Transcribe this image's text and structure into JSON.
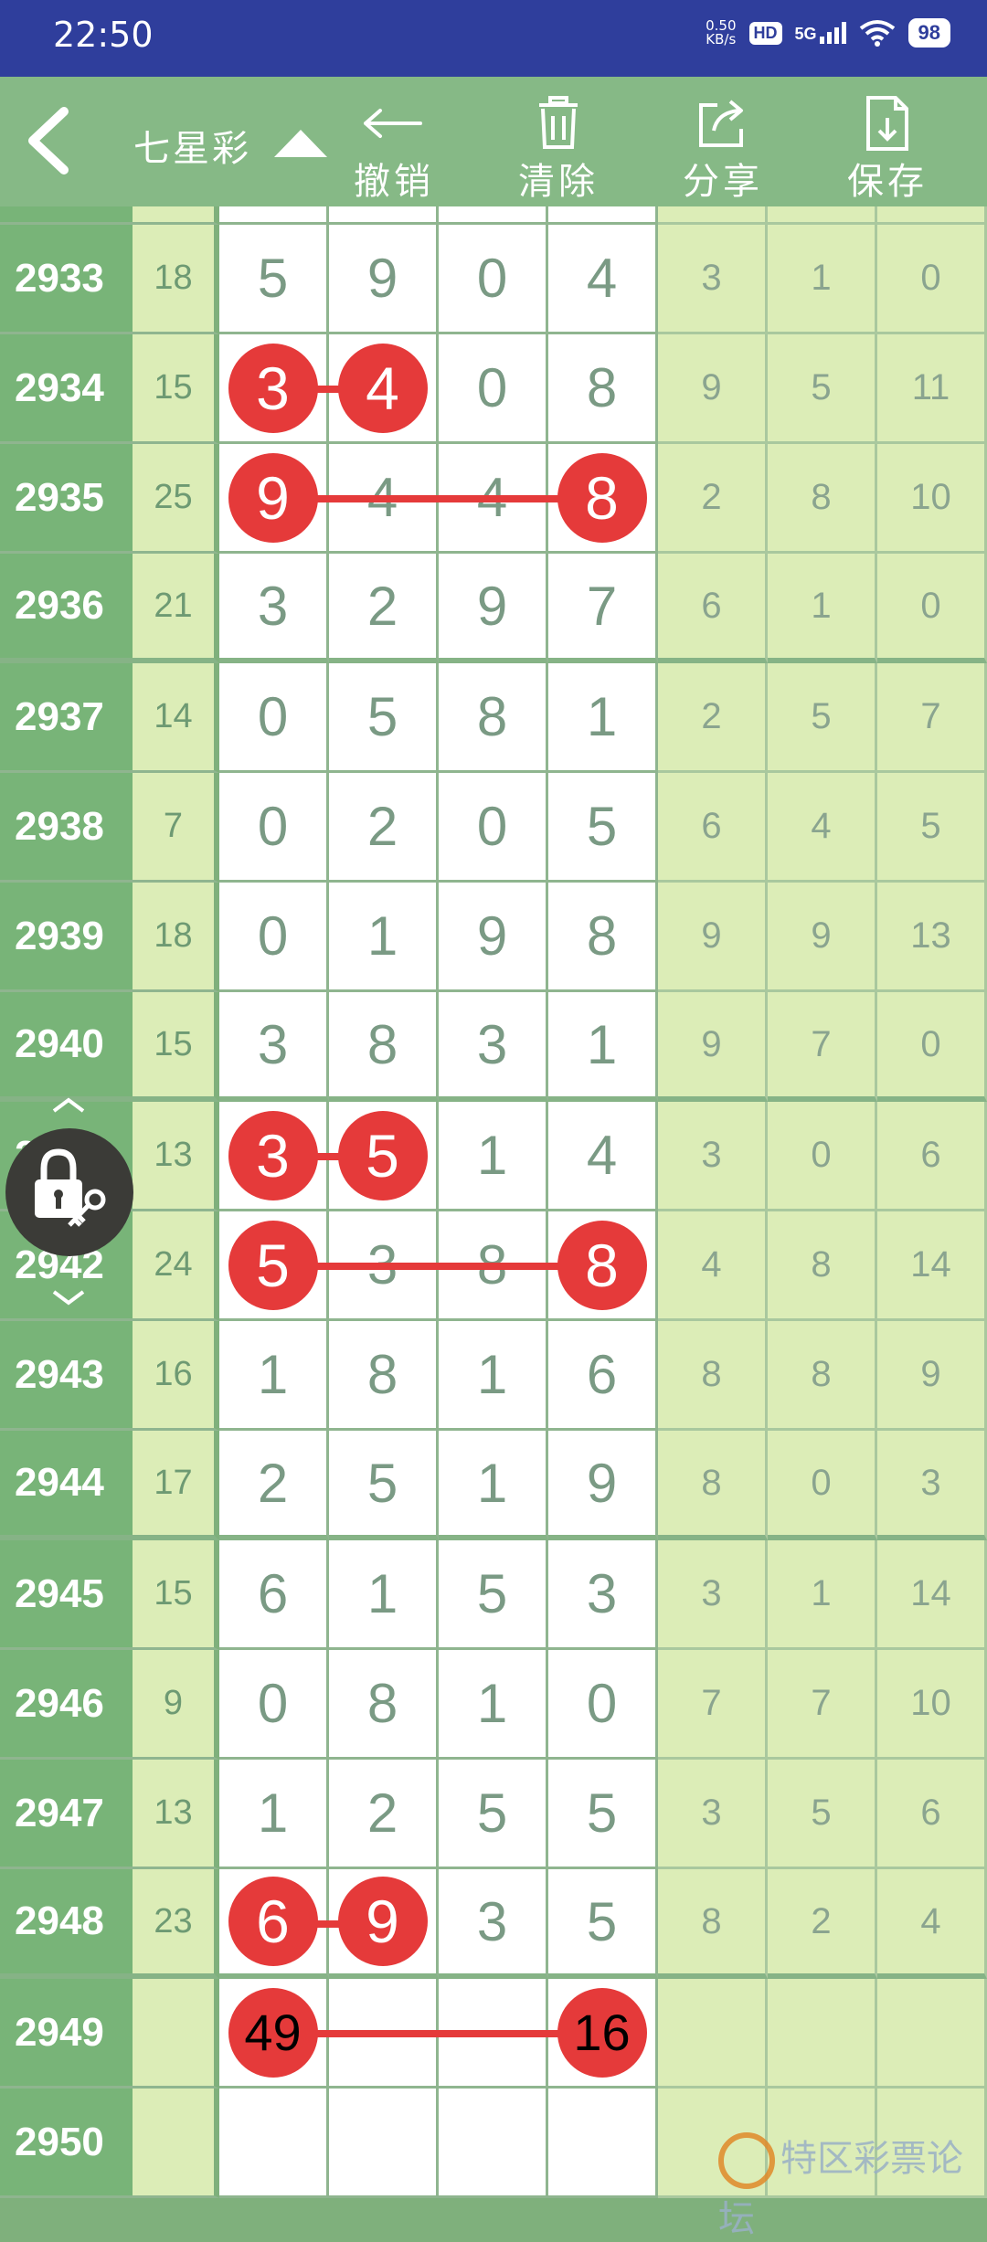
{
  "status": {
    "time": "22:50",
    "net_speed_value": "0.50",
    "net_speed_unit": "KB/s",
    "hd": "HD",
    "network": "5G",
    "battery": "98"
  },
  "toolbar": {
    "title": "七星彩",
    "undo_label": "撤销",
    "clear_label": "清除",
    "share_label": "分享",
    "save_label": "保存"
  },
  "rows": [
    {
      "period": "2933",
      "sum": "18",
      "digits": [
        "5",
        "9",
        "0",
        "4"
      ],
      "stats": [
        "3",
        "1",
        "0"
      ]
    },
    {
      "period": "2934",
      "sum": "15",
      "digits": [
        "3",
        "4",
        "0",
        "8"
      ],
      "stats": [
        "9",
        "5",
        "11"
      ],
      "balls": [
        0,
        1
      ]
    },
    {
      "period": "2935",
      "sum": "25",
      "digits": [
        "9",
        "4",
        "4",
        "8"
      ],
      "stats": [
        "2",
        "8",
        "10"
      ],
      "balls": [
        0,
        3
      ]
    },
    {
      "period": "2936",
      "sum": "21",
      "digits": [
        "3",
        "2",
        "9",
        "7"
      ],
      "stats": [
        "6",
        "1",
        "0"
      ]
    },
    {
      "period": "2937",
      "sum": "14",
      "digits": [
        "0",
        "5",
        "8",
        "1"
      ],
      "stats": [
        "2",
        "5",
        "7"
      ]
    },
    {
      "period": "2938",
      "sum": "7",
      "digits": [
        "0",
        "2",
        "0",
        "5"
      ],
      "stats": [
        "6",
        "4",
        "5"
      ]
    },
    {
      "period": "2939",
      "sum": "18",
      "digits": [
        "0",
        "1",
        "9",
        "8"
      ],
      "stats": [
        "9",
        "9",
        "13"
      ]
    },
    {
      "period": "2940",
      "sum": "15",
      "digits": [
        "3",
        "8",
        "3",
        "1"
      ],
      "stats": [
        "9",
        "7",
        "0"
      ]
    },
    {
      "period": "2941",
      "sum": "13",
      "digits": [
        "3",
        "5",
        "1",
        "4"
      ],
      "stats": [
        "3",
        "0",
        "6"
      ],
      "balls": [
        0,
        1
      ]
    },
    {
      "period": "2942",
      "sum": "24",
      "digits": [
        "5",
        "3",
        "8",
        "8"
      ],
      "stats": [
        "4",
        "8",
        "14"
      ],
      "balls": [
        0,
        3
      ]
    },
    {
      "period": "2943",
      "sum": "16",
      "digits": [
        "1",
        "8",
        "1",
        "6"
      ],
      "stats": [
        "8",
        "8",
        "9"
      ]
    },
    {
      "period": "2944",
      "sum": "17",
      "digits": [
        "2",
        "5",
        "1",
        "9"
      ],
      "stats": [
        "8",
        "0",
        "3"
      ]
    },
    {
      "period": "2945",
      "sum": "15",
      "digits": [
        "6",
        "1",
        "5",
        "3"
      ],
      "stats": [
        "3",
        "1",
        "14"
      ]
    },
    {
      "period": "2946",
      "sum": "9",
      "digits": [
        "0",
        "8",
        "1",
        "0"
      ],
      "stats": [
        "7",
        "7",
        "10"
      ]
    },
    {
      "period": "2947",
      "sum": "13",
      "digits": [
        "1",
        "2",
        "5",
        "5"
      ],
      "stats": [
        "3",
        "5",
        "6"
      ]
    },
    {
      "period": "2948",
      "sum": "23",
      "digits": [
        "6",
        "9",
        "3",
        "5"
      ],
      "stats": [
        "8",
        "2",
        "4"
      ],
      "balls": [
        0,
        1
      ]
    },
    {
      "period": "2949",
      "sum": "",
      "digits": [
        "49",
        "",
        "",
        "16"
      ],
      "stats": [
        "",
        "",
        ""
      ],
      "balls": [
        0,
        3
      ],
      "dark": true
    },
    {
      "period": "2950",
      "sum": "",
      "digits": [
        "",
        "",
        "",
        ""
      ],
      "stats": [
        "",
        "",
        ""
      ]
    }
  ],
  "watermark": "特区彩票论坛",
  "colors": {
    "ball": "#e53a3a",
    "header": "#86b986",
    "statusbar": "#2f3e9c"
  }
}
